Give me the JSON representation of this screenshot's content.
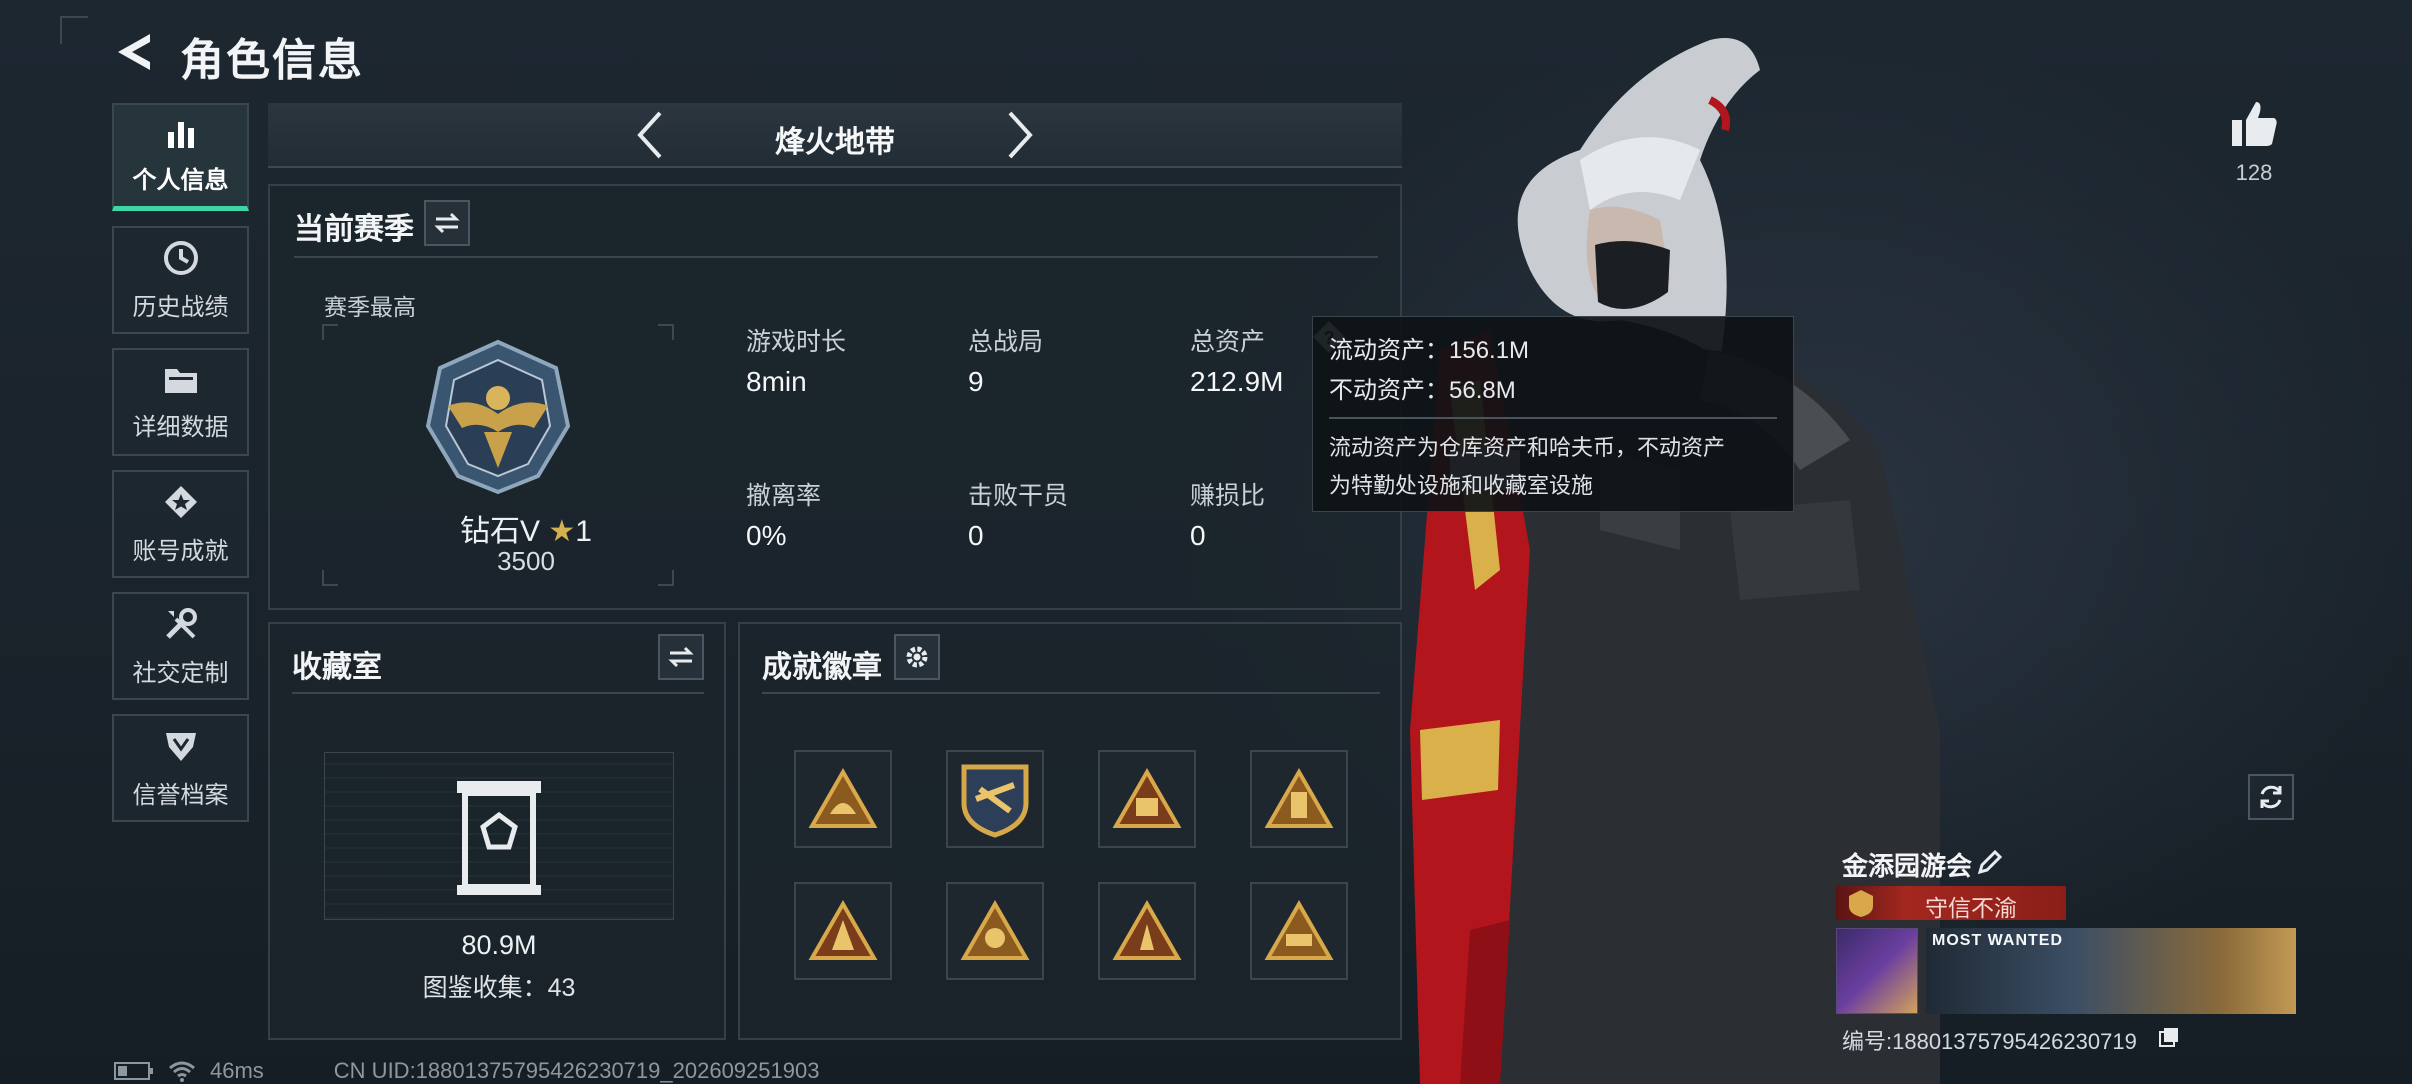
{
  "header": {
    "title": "角色信息"
  },
  "sidebar": {
    "items": [
      {
        "label": "个人信息",
        "icon": "bar-chart-icon",
        "active": true
      },
      {
        "label": "历史战绩",
        "icon": "history-clock-icon"
      },
      {
        "label": "详细数据",
        "icon": "folder-icon"
      },
      {
        "label": "账号成就",
        "icon": "achievement-star-icon"
      },
      {
        "label": "社交定制",
        "icon": "wrench-tools-icon"
      },
      {
        "label": "信誉档案",
        "icon": "shield-badge-icon"
      }
    ]
  },
  "mode": {
    "title": "烽火地带"
  },
  "season": {
    "title": "当前赛季",
    "best_label": "赛季最高",
    "rank_name": "钻石V",
    "rank_stars": "1",
    "rank_score": "3500",
    "stats": [
      {
        "label": "游戏时长",
        "value": "8min"
      },
      {
        "label": "总战局",
        "value": "9"
      },
      {
        "label": "总资产",
        "value": "212.9M"
      },
      {
        "label": "撤离率",
        "value": "0%"
      },
      {
        "label": "击败干员",
        "value": "0"
      },
      {
        "label": "赚损比",
        "value": "0"
      }
    ]
  },
  "tooltip": {
    "liquid": "流动资产：156.1M",
    "fixed": "不动资产：56.8M",
    "desc_line1": "流动资产为仓库资产和哈夫币，不动资产",
    "desc_line2": "为特勤处设施和收藏室设施"
  },
  "collection": {
    "title": "收藏室",
    "value": "80.9M",
    "catalog": "图鉴收集：43"
  },
  "badges": {
    "title": "成就徽章",
    "count": 8
  },
  "likes": {
    "count": "128"
  },
  "profile_card": {
    "name": "金添园游会",
    "title_badge": "守信不渝",
    "banner_text": "MOST WANTED",
    "uid_label": "编号:18801375795426230719"
  },
  "status": {
    "ping": "46ms",
    "uid_line": "CN UID:18801375795426230719_202609251903"
  },
  "colors": {
    "accent": "#3fd6a6",
    "title_badge": "#a3271f",
    "gold": "#c9a14a",
    "weapon_red": "#b3151c"
  }
}
